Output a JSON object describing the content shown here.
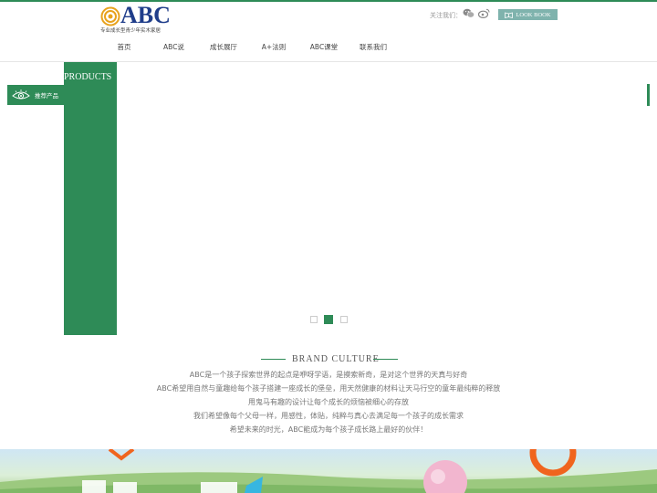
{
  "header": {
    "logo_text": "ABC",
    "logo_tagline": "专业成长型青少年实木家居",
    "follow_label": "关注我们：",
    "lookbook_label": "LOOK BOOK"
  },
  "nav": {
    "items": [
      "首页",
      "ABC说",
      "成长展厅",
      "A+法则",
      "ABC课堂",
      "联系我们"
    ]
  },
  "products": {
    "title": "PRODUCTS",
    "recommended_label": "推荐产品"
  },
  "slider": {
    "total_slides": 3,
    "active_slide": 2
  },
  "brand": {
    "title": "BRAND CULTURE",
    "lines": [
      "ABC是一个孩子探索世界的起点是咿呀学语，是摸索新奇，是对这个世界的天真与好奇",
      "ABC希望用自然与童趣给每个孩子搭建一座成长的堡垒，用天然健康的材料让天马行空的童年最纯粹的释放",
      "用鬼马有趣的设计让每个成长的烦恼被细心的存放",
      "我们希望像每个父母一样，用感性，体贴，纯粹与真心去满足每一个孩子的成长需求",
      "希望未来的时光，ABC能成为每个孩子成长路上最好的伙伴！"
    ]
  },
  "colors": {
    "accent_green": "#2e8b57",
    "logo_blue": "#1f3d8a",
    "logo_orange": "#e8a21c",
    "lookbook_bg": "#7fb3ad",
    "banner_orange": "#f0641e"
  }
}
